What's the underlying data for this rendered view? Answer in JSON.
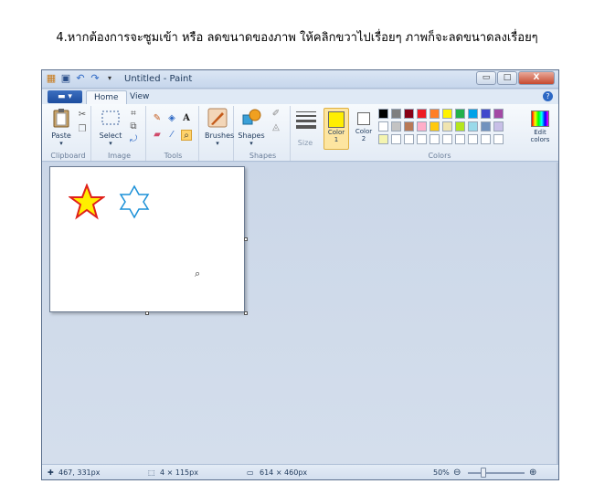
{
  "caption": "4.หากต้องการจะซูมเข้า หรือ ลดขนาดของภาพ ให้คลิกขวาไปเรื่อยๆ ภาพก็จะลดขนาดลงเรื่อยๆ",
  "window": {
    "title": "Untitled - Paint",
    "controls": {
      "minimize": "▭",
      "maximize": "□",
      "close": "X"
    }
  },
  "tabs": {
    "menu": "▬ ▾",
    "home": "Home",
    "view": "View",
    "help": "?"
  },
  "ribbon": {
    "clipboard": {
      "label": "Clipboard",
      "paste": "Paste"
    },
    "image": {
      "label": "Image",
      "select": "Select"
    },
    "tools": {
      "label": "Tools",
      "text_tool": "A"
    },
    "brushes": {
      "label": "Brushes"
    },
    "shapes": {
      "label": "Shapes",
      "button": "Shapes"
    },
    "size": {
      "label": "Size"
    },
    "colors": {
      "label": "Colors",
      "color1": "Color\n1",
      "color1_line1": "Color",
      "color1_line2": "1",
      "color2_line1": "Color",
      "color2_line2": "2",
      "edit_line1": "Edit",
      "edit_line2": "colors",
      "color1_value": "#ffee00",
      "color2_value": "#ffffff",
      "palette_row1": [
        "#000000",
        "#7f7f7f",
        "#880015",
        "#ed1c24",
        "#ff7f27",
        "#fff200",
        "#22b14c",
        "#00a2e8",
        "#3f48cc",
        "#a349a4"
      ],
      "palette_row2": [
        "#ffffff",
        "#c3c3c3",
        "#b97a57",
        "#ffaec9",
        "#ffc90e",
        "#efe4b0",
        "#b5e61d",
        "#99d9ea",
        "#7092be",
        "#c8bfe7"
      ],
      "palette_row3": [
        "#f4f4b0",
        "#ffffff",
        "#ffffff",
        "#ffffff",
        "#ffffff",
        "#ffffff",
        "#ffffff",
        "#ffffff",
        "#ffffff",
        "#ffffff"
      ]
    }
  },
  "status": {
    "cursor_pos": "467, 331px",
    "selection_size": "4 × 115px",
    "image_size": "614 × 460px",
    "zoom": "50%",
    "zoom_fraction": 0.25
  },
  "icons": {
    "cursor": "crosshair-icon",
    "selection": "selection-size-icon",
    "image": "image-size-icon",
    "zoom_out": "zoom-out-icon",
    "zoom_in": "zoom-in-icon",
    "magnifier": "magnifier-icon"
  }
}
